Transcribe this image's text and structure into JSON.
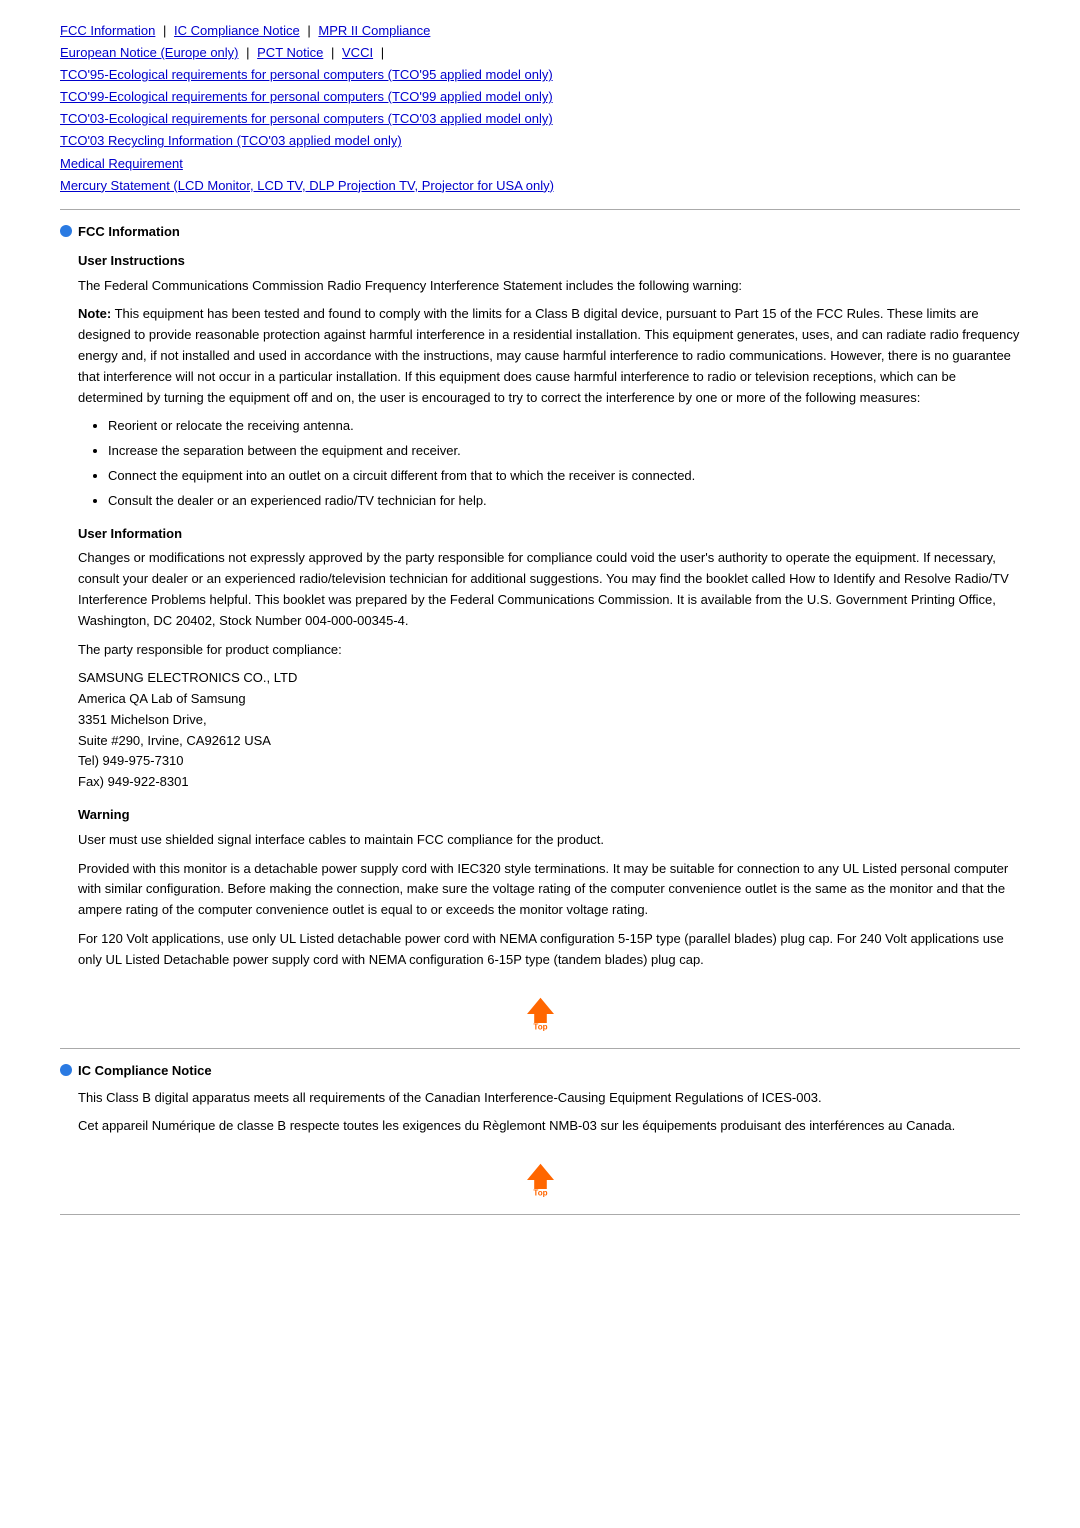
{
  "nav": {
    "links": [
      {
        "label": "FCC Information",
        "id": "fcc"
      },
      {
        "label": "IC Compliance Notice",
        "id": "ic"
      },
      {
        "label": "MPR II Compliance",
        "id": "mpr"
      },
      {
        "label": "European Notice (Europe only)",
        "id": "european"
      },
      {
        "label": "PCT Notice",
        "id": "pct"
      },
      {
        "label": "VCCI",
        "id": "vcci"
      },
      {
        "label": "TCO'95-Ecological requirements for personal computers (TCO'95 applied model only)",
        "id": "tco95"
      },
      {
        "label": "TCO'99-Ecological requirements for personal computers (TCO'99 applied model only)",
        "id": "tco99"
      },
      {
        "label": "TCO'03-Ecological requirements for personal computers (TCO'03 applied model only)",
        "id": "tco03"
      },
      {
        "label": "TCO'03 Recycling Information (TCO'03 applied model only)",
        "id": "tco03r"
      },
      {
        "label": "Medical Requirement",
        "id": "medical"
      },
      {
        "label": "Mercury Statement (LCD Monitor, LCD TV, DLP Projection TV, Projector for USA only)",
        "id": "mercury"
      }
    ]
  },
  "fcc_section": {
    "title": "FCC Information",
    "user_instructions": {
      "heading": "User Instructions",
      "intro": "The Federal Communications Commission Radio Frequency Interference Statement includes the following warning:",
      "note_bold": "Note:",
      "note_text": " This equipment has been tested and found to comply with the limits for a Class B digital device, pursuant to Part 15 of the FCC Rules. These limits are designed to provide reasonable protection against harmful interference in a residential installation. This equipment generates, uses, and can radiate radio frequency energy and, if not installed and used in accordance with the instructions, may cause harmful interference to radio communications. However, there is no guarantee that interference will not occur in a particular installation. If this equipment does cause harmful interference to radio or television receptions, which can be determined by turning the equipment off and on, the user is encouraged to try to correct the interference by one or more of the following measures:",
      "bullets": [
        "Reorient or relocate the receiving antenna.",
        "Increase the separation between the equipment and receiver.",
        "Connect the equipment into an outlet on a circuit different from that to which the receiver is connected.",
        "Consult the dealer or an experienced radio/TV technician for help."
      ]
    },
    "user_information": {
      "heading": "User Information",
      "text1": "Changes or modifications not expressly approved by the party responsible for compliance could void the user's authority to operate the equipment. If necessary, consult your dealer or an experienced radio/television technician for additional suggestions. You may find the booklet called How to Identify and Resolve Radio/TV Interference Problems helpful. This booklet was prepared by the Federal Communications Commission. It is available from the U.S. Government Printing Office, Washington, DC 20402, Stock Number 004-000-00345-4.",
      "text2": "The party responsible for product compliance:",
      "company_lines": [
        "SAMSUNG ELECTRONICS CO., LTD",
        "America QA Lab of Samsung",
        "3351 Michelson Drive,",
        "Suite #290, Irvine, CA92612 USA",
        "Tel) 949-975-7310",
        "Fax) 949-922-8301"
      ]
    },
    "warning": {
      "heading": "Warning",
      "text1": "User must use shielded signal interface cables to maintain FCC compliance for the product.",
      "text2": "Provided with this monitor is a detachable power supply cord with IEC320 style terminations. It may be suitable for connection to any UL Listed personal computer with similar configuration. Before making the connection, make sure the voltage rating of the computer convenience outlet is the same as the monitor and that the ampere rating of the computer convenience outlet is equal to or exceeds the monitor voltage rating.",
      "text3": "For 120 Volt applications, use only UL Listed detachable power cord with NEMA configuration 5-15P type (parallel blades) plug cap. For 240 Volt applications use only UL Listed Detachable power supply cord with NEMA configuration 6-15P type (tandem blades) plug cap."
    }
  },
  "ic_section": {
    "title": "IC Compliance Notice",
    "text1": "This Class B digital apparatus meets all requirements of the Canadian Interference-Causing Equipment Regulations of ICES-003.",
    "text2": "Cet appareil Numérique de classe B respecte toutes les exigences du Règlemont NMB-03 sur les équipements produisant des interférences au Canada."
  },
  "top_label": "Top"
}
